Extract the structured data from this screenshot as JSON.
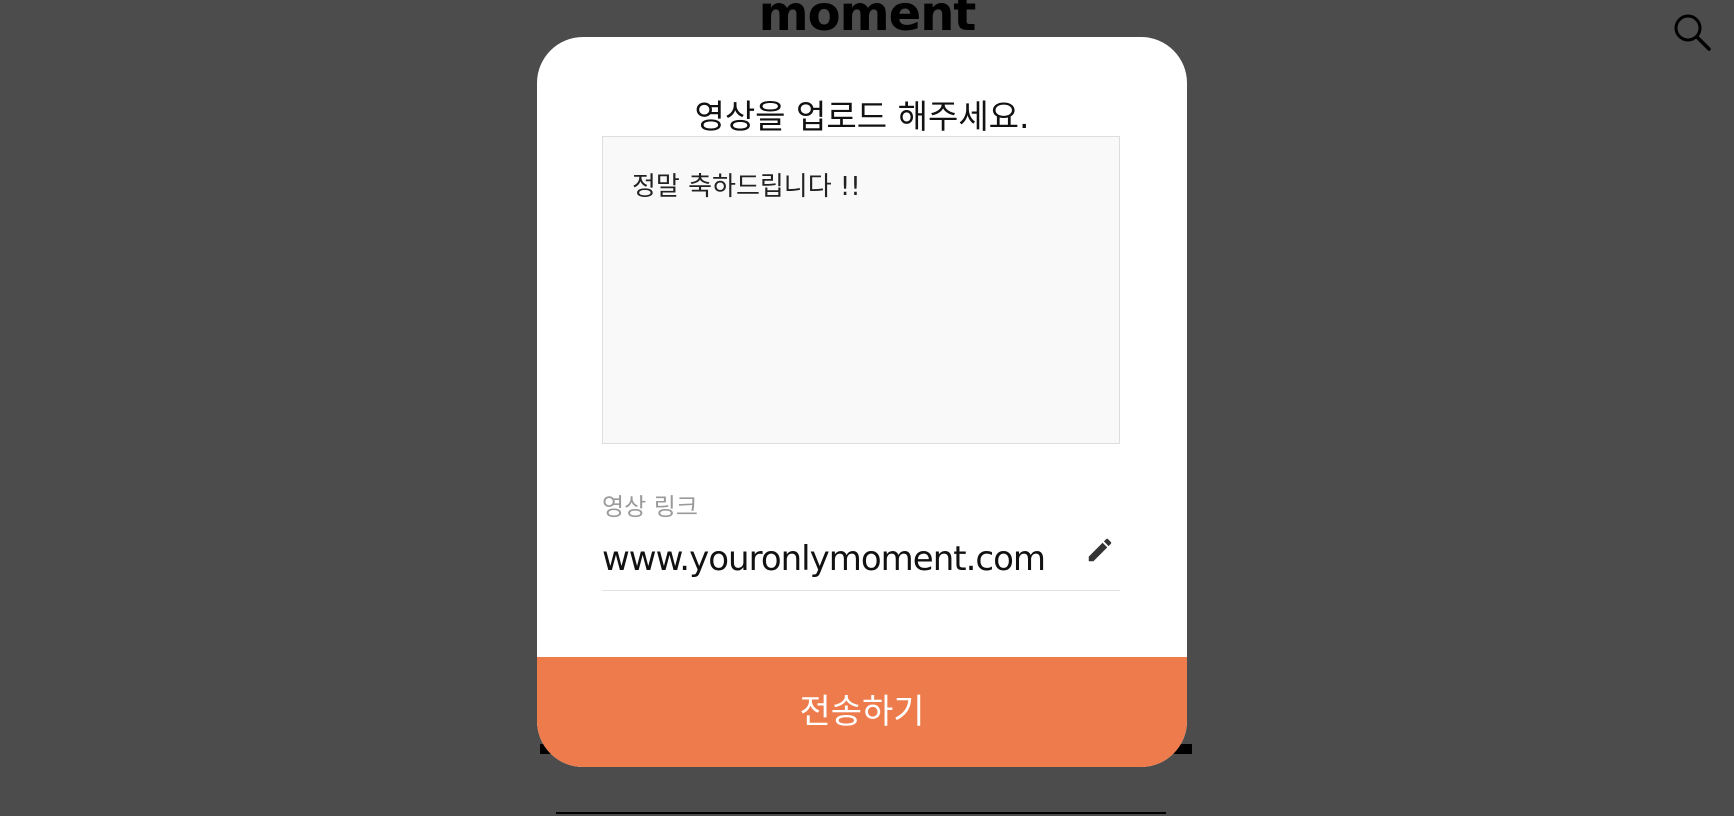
{
  "background": {
    "logo_text": "moment",
    "search_icon": "search-icon"
  },
  "modal": {
    "title": "영상을 업로드 해주세요.",
    "message": "정말 축하드립니다 !!",
    "link_label": "영상 링크",
    "link_value": "www.youronlymoment.com",
    "edit_icon": "pencil-icon",
    "submit_label": "전송하기"
  },
  "colors": {
    "overlay": "#4d4d4d",
    "accent": "#ee7b4b",
    "modal_bg": "#ffffff",
    "textarea_bg": "#f9f9f9"
  }
}
